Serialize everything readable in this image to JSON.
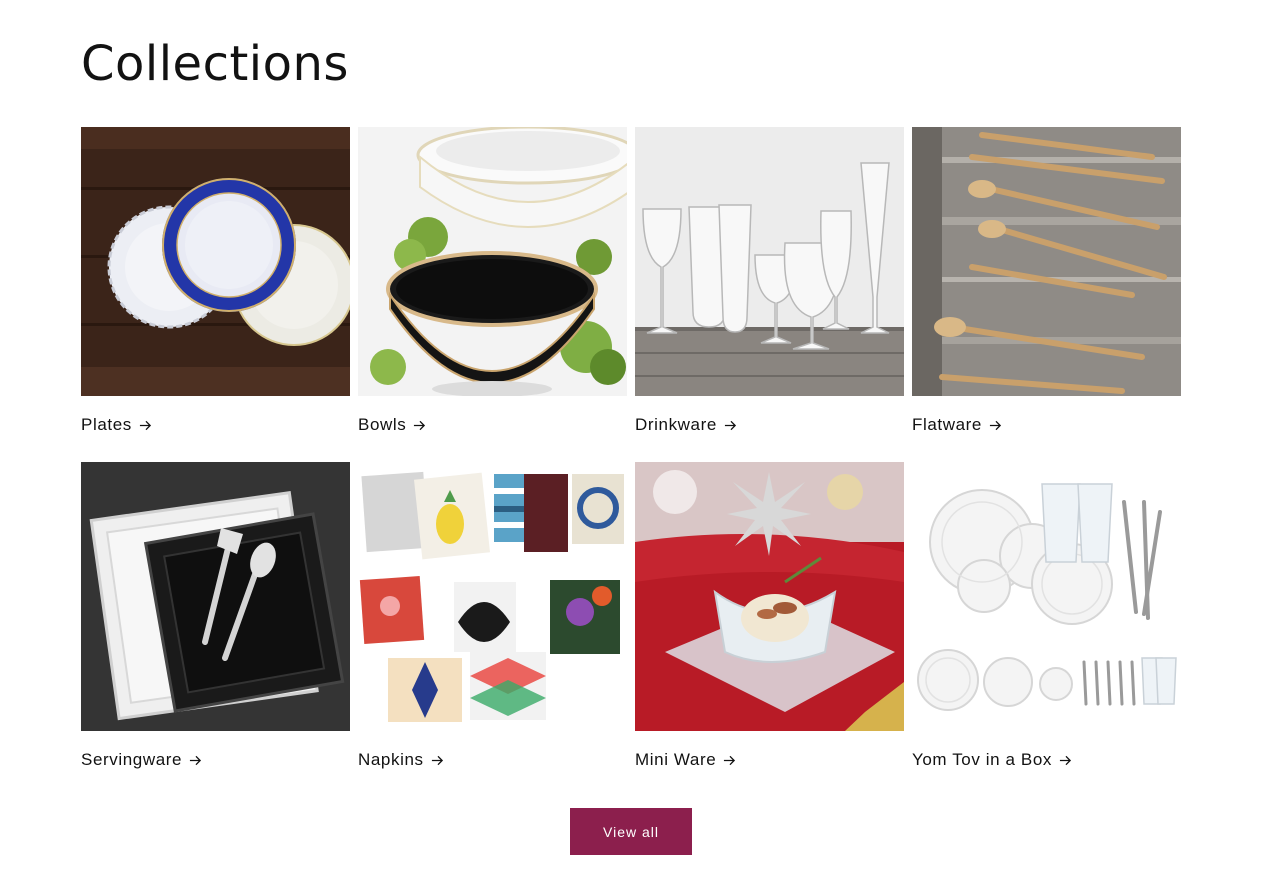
{
  "section": {
    "heading": "Collections",
    "collections": [
      {
        "label": "Plates"
      },
      {
        "label": "Bowls"
      },
      {
        "label": "Drinkware"
      },
      {
        "label": "Flatware"
      },
      {
        "label": "Servingware"
      },
      {
        "label": "Napkins"
      },
      {
        "label": "Mini Ware"
      },
      {
        "label": "Yom Tov in a Box"
      }
    ],
    "view_all_label": "View all"
  },
  "colors": {
    "button": "#8c1f4d",
    "text": "#121212",
    "background": "#ffffff"
  },
  "icons": {
    "collection_link": "arrow-right-icon"
  }
}
